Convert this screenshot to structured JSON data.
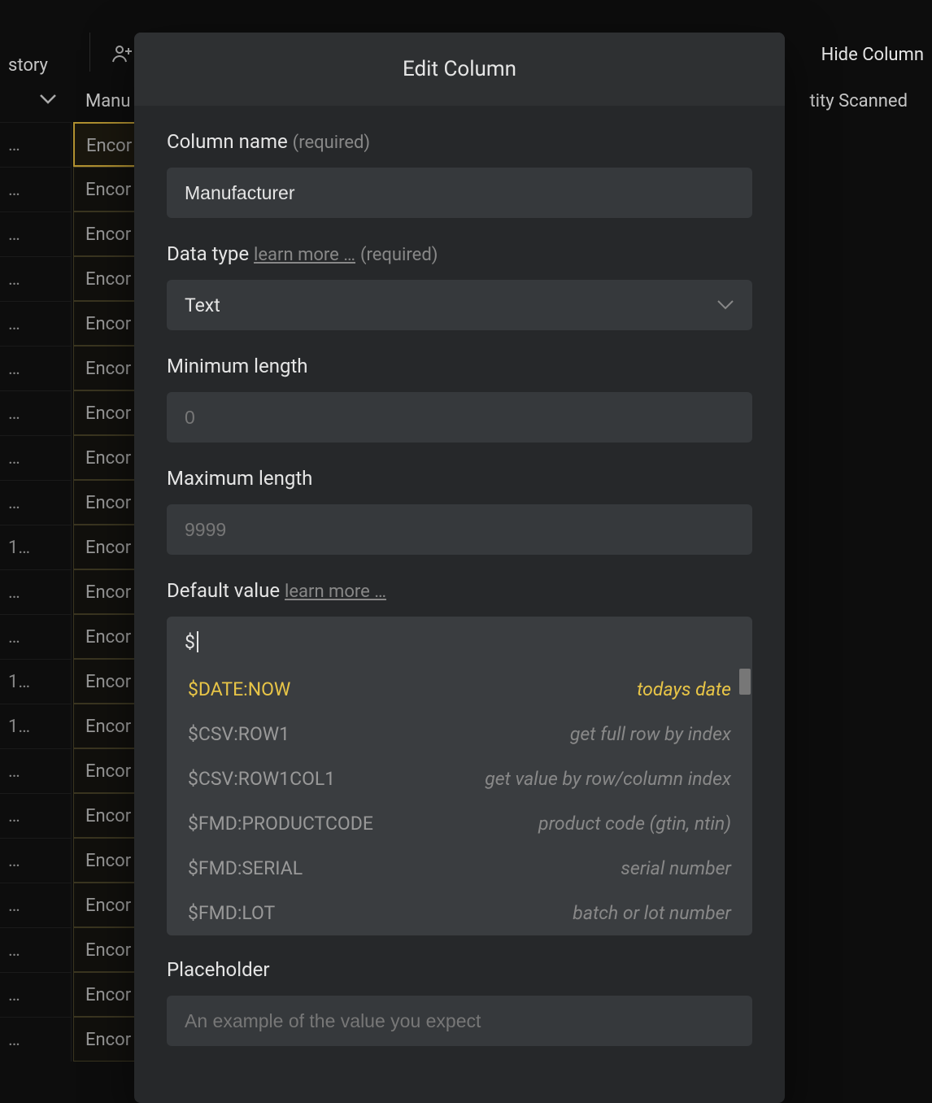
{
  "toolbar": {
    "left_tab": "story",
    "hide_columns": "Hide Column"
  },
  "table": {
    "header_col2": "Manu",
    "header_right": "tity Scanned",
    "col1_cells": [
      "…",
      "…",
      "…",
      "…",
      "…",
      "…",
      "…",
      "…",
      "…",
      "1…",
      "…",
      "…",
      "1…",
      "1…",
      "…",
      "…",
      "…",
      "…",
      "…",
      "…",
      "…"
    ],
    "col2_cells": [
      "Encor",
      "Encor",
      "Encor",
      "Encor",
      "Encor",
      "Encor",
      "Encor",
      "Encor",
      "Encor",
      "Encor",
      "Encor",
      "Encor",
      "Encor",
      "Encor",
      "Encor",
      "Encor",
      "Encor",
      "Encor",
      "Encor",
      "Encor",
      "Encor"
    ]
  },
  "modal": {
    "title": "Edit Column",
    "column_name": {
      "label": "Column name",
      "required": "(required)",
      "value": "Manufacturer"
    },
    "data_type": {
      "label": "Data type",
      "learn_more": "learn more …",
      "required": "(required)",
      "value": "Text"
    },
    "min_length": {
      "label": "Minimum length",
      "placeholder": "0"
    },
    "max_length": {
      "label": "Maximum length",
      "placeholder": "9999"
    },
    "default_value": {
      "label": "Default value",
      "learn_more": "learn more …",
      "value": "$",
      "suggestions": [
        {
          "key": "$DATE:NOW",
          "desc": "todays date",
          "selected": true
        },
        {
          "key": "$CSV:ROW1",
          "desc": "get full row by index",
          "selected": false
        },
        {
          "key": "$CSV:ROW1COL1",
          "desc": "get value by row/column index",
          "selected": false
        },
        {
          "key": "$FMD:PRODUCTCODE",
          "desc": "product code (gtin, ntin)",
          "selected": false
        },
        {
          "key": "$FMD:SERIAL",
          "desc": "serial number",
          "selected": false
        },
        {
          "key": "$FMD:LOT",
          "desc": "batch or lot number",
          "selected": false
        }
      ]
    },
    "placeholder_field": {
      "label": "Placeholder",
      "placeholder": "An example of the value you expect"
    }
  }
}
